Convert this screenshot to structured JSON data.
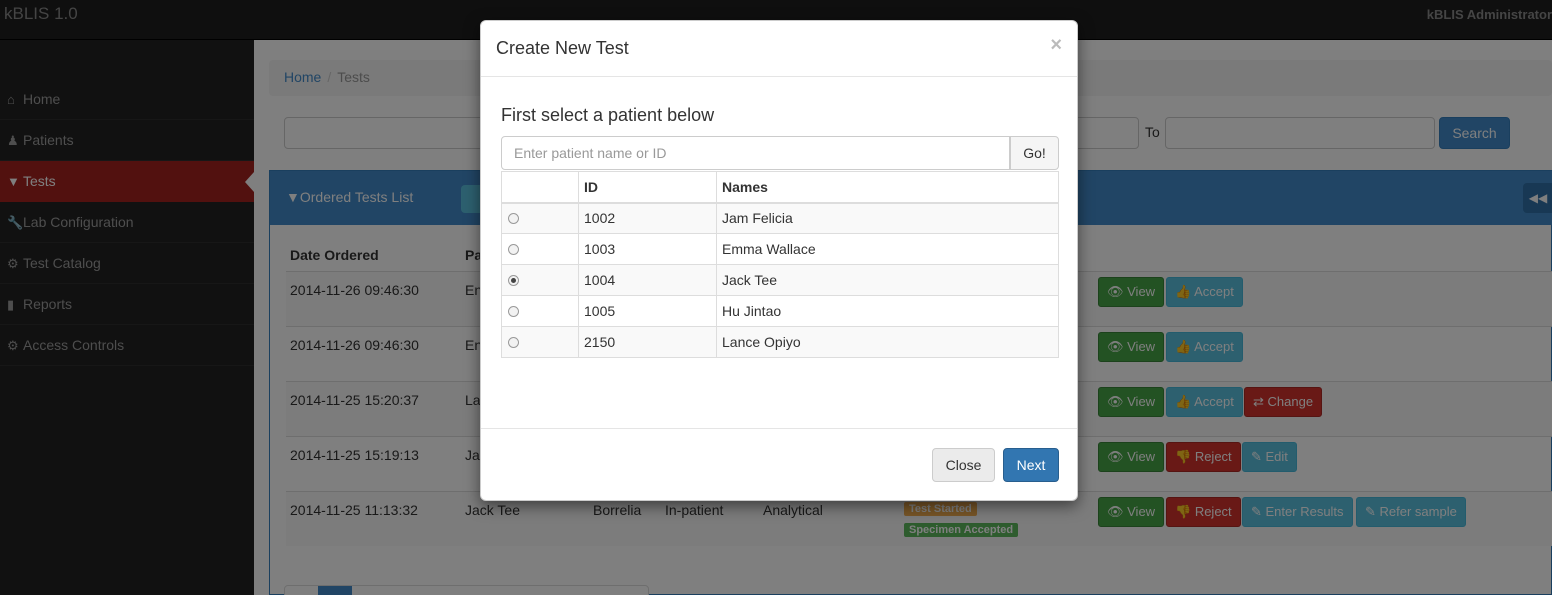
{
  "app": {
    "brand": "kBLIS 1.0",
    "user": "kBLIS Administrator"
  },
  "sidebar": {
    "items": [
      {
        "label": "Home",
        "icon": "home-icon",
        "glyph": "⌂"
      },
      {
        "label": "Patients",
        "icon": "user-icon",
        "glyph": "♟"
      },
      {
        "label": "Tests",
        "icon": "filter-icon",
        "glyph": "▼",
        "active": true
      },
      {
        "label": "Lab Configuration",
        "icon": "wrench-icon",
        "glyph": "🔧"
      },
      {
        "label": "Test Catalog",
        "icon": "cog-icon",
        "glyph": "⚙"
      },
      {
        "label": "Reports",
        "icon": "chart-icon",
        "glyph": "▮"
      },
      {
        "label": "Access Controls",
        "icon": "cog-icon",
        "glyph": "⚙"
      }
    ]
  },
  "breadcrumb": {
    "home": "Home",
    "current": "Tests"
  },
  "search": {
    "to_label": "To",
    "button": "Search"
  },
  "panel": {
    "title": "Ordered Tests List",
    "collapse_glyph": "◀◀"
  },
  "table": {
    "headers": {
      "date": "Date Ordered",
      "patient": "Pa"
    },
    "rows": [
      {
        "date": "2014-11-26 09:46:30",
        "patient": "En",
        "buttons": [
          "View",
          "Accept"
        ]
      },
      {
        "date": "2014-11-26 09:46:30",
        "patient": "En",
        "buttons": [
          "View",
          "Accept"
        ]
      },
      {
        "date": "2014-11-25 15:20:37",
        "patient": "La",
        "buttons": [
          "View",
          "Accept",
          "Change"
        ]
      },
      {
        "date": "2014-11-25 15:19:13",
        "patient": "Ja",
        "buttons": [
          "View",
          "Reject",
          "Edit"
        ]
      },
      {
        "date": "2014-11-25 11:13:32",
        "patient": "Jack Tee",
        "test": "Borrelia",
        "visit": "In-patient",
        "section": "Analytical",
        "status": [
          "Test Started",
          "Specimen Accepted"
        ],
        "buttons": [
          "View",
          "Reject",
          "Enter Results",
          "Refer sample"
        ]
      }
    ]
  },
  "modal": {
    "title": "Create New Test",
    "close_glyph": "×",
    "prompt": "First select a patient below",
    "search_placeholder": "Enter patient name or ID",
    "go_button": "Go!",
    "columns": {
      "select": "",
      "id": "ID",
      "names": "Names"
    },
    "patients": [
      {
        "id": "1002",
        "name": "Jam Felicia",
        "selected": false
      },
      {
        "id": "1003",
        "name": "Emma Wallace",
        "selected": false
      },
      {
        "id": "1004",
        "name": "Jack Tee",
        "selected": true
      },
      {
        "id": "1005",
        "name": "Hu Jintao",
        "selected": false
      },
      {
        "id": "2150",
        "name": "Lance Opiyo",
        "selected": false
      }
    ],
    "close_button": "Close",
    "next_button": "Next"
  },
  "colors": {
    "sidebar_active": "#a5221e",
    "primary": "#428bca",
    "success": "#47a447",
    "info": "#5bc0de",
    "danger": "#d2322d"
  }
}
